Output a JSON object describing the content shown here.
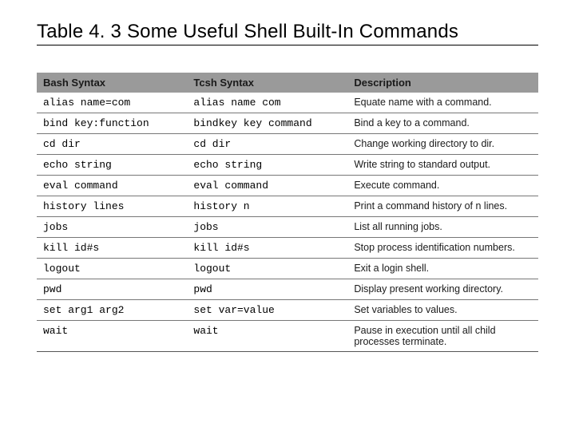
{
  "caption": "Table 4. 3  Some Useful Shell Built-In Commands",
  "headers": {
    "bash": "Bash Syntax",
    "tcsh": "Tcsh Syntax",
    "desc": "Description"
  },
  "rows": [
    {
      "bash": "alias name=com",
      "tcsh": "alias name com",
      "desc": "Equate name with a command."
    },
    {
      "bash": "bind key:function",
      "tcsh": "bindkey key command",
      "desc": "Bind a key to a command."
    },
    {
      "bash": "cd dir",
      "tcsh": "cd dir",
      "desc": "Change working directory to dir."
    },
    {
      "bash": "echo string",
      "tcsh": "echo string",
      "desc": "Write string to standard output."
    },
    {
      "bash": "eval command",
      "tcsh": "eval command",
      "desc": "Execute command."
    },
    {
      "bash": "history lines",
      "tcsh": "history n",
      "desc": "Print a command history of n lines."
    },
    {
      "bash": "jobs",
      "tcsh": "jobs",
      "desc": "List all running jobs."
    },
    {
      "bash": "kill id#s",
      "tcsh": "kill id#s",
      "desc": "Stop process identification numbers."
    },
    {
      "bash": "logout",
      "tcsh": "logout",
      "desc": "Exit a login shell."
    },
    {
      "bash": "pwd",
      "tcsh": "pwd",
      "desc": "Display present working directory."
    },
    {
      "bash": "set arg1 arg2",
      "tcsh": "set var=value",
      "desc": "Set variables to values."
    },
    {
      "bash": "wait",
      "tcsh": "wait",
      "desc": "Pause in execution until all child processes terminate."
    }
  ],
  "chart_data": {
    "type": "table",
    "title": "Table 4.3 Some Useful Shell Built-In Commands",
    "columns": [
      "Bash Syntax",
      "Tcsh Syntax",
      "Description"
    ],
    "rows": [
      [
        "alias name=com",
        "alias name com",
        "Equate name with a command."
      ],
      [
        "bind key:function",
        "bindkey key command",
        "Bind a key to a command."
      ],
      [
        "cd dir",
        "cd dir",
        "Change working directory to dir."
      ],
      [
        "echo string",
        "echo string",
        "Write string to standard output."
      ],
      [
        "eval command",
        "eval command",
        "Execute command."
      ],
      [
        "history lines",
        "history n",
        "Print a command history of n lines."
      ],
      [
        "jobs",
        "jobs",
        "List all running jobs."
      ],
      [
        "kill id#s",
        "kill id#s",
        "Stop process identification numbers."
      ],
      [
        "logout",
        "logout",
        "Exit a login shell."
      ],
      [
        "pwd",
        "pwd",
        "Display present working directory."
      ],
      [
        "set arg1 arg2",
        "set var=value",
        "Set variables to values."
      ],
      [
        "wait",
        "wait",
        "Pause in execution until all child processes terminate."
      ]
    ]
  }
}
